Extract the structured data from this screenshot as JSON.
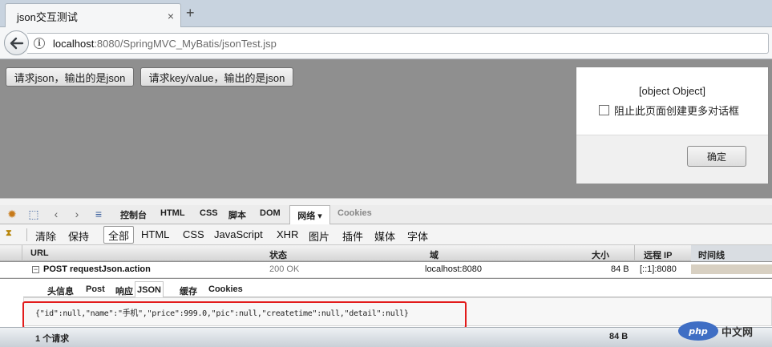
{
  "browser": {
    "tab_title": "json交互测试",
    "tab_close": "×",
    "new_tab": "+",
    "back_glyph": "🡐",
    "info_glyph": "i",
    "url_host": "localhost",
    "url_rest": ":8080/SpringMVC_MyBatis/jsonTest.jsp"
  },
  "page": {
    "button1": "请求json，输出的是json",
    "button2": "请求key/value，输出的是json"
  },
  "dialog": {
    "message": "[object Object]",
    "checkbox_label": "阻止此页面创建更多对话框",
    "ok_label": "确定"
  },
  "firebug": {
    "tabs": {
      "console": "控制台",
      "html": "HTML",
      "css": "CSS",
      "script": "脚本",
      "dom": "DOM",
      "net": "网络 ▾",
      "cookies": "Cookies"
    },
    "filters": {
      "clear": "清除",
      "persist": "保持",
      "all": "全部",
      "html": "HTML",
      "css": "CSS",
      "js": "JavaScript",
      "xhr": "XHR",
      "images": "图片",
      "plugins": "插件",
      "media": "媒体",
      "fonts": "字体"
    },
    "columns": {
      "url": "URL",
      "status": "状态",
      "domain": "域",
      "size": "大小",
      "remote_ip": "远程 IP",
      "timeline": "时间线"
    },
    "request": {
      "url": "POST requestJson.action",
      "status": "200 OK",
      "domain": "localhost:8080",
      "size": "84 B",
      "remote_ip": "[::1]:8080"
    },
    "detail_tabs": {
      "headers": "头信息",
      "post": "Post",
      "response": "响应",
      "json": "JSON",
      "cache": "缓存",
      "cookies": "Cookies"
    },
    "response_body": "{\"id\":null,\"name\":\"手机\",\"price\":999.0,\"pic\":null,\"createtime\":null,\"detail\":null}",
    "footer": {
      "count": "1 个请求",
      "total": "84 B"
    }
  },
  "watermark": {
    "logo": "php",
    "text": "中文网"
  }
}
